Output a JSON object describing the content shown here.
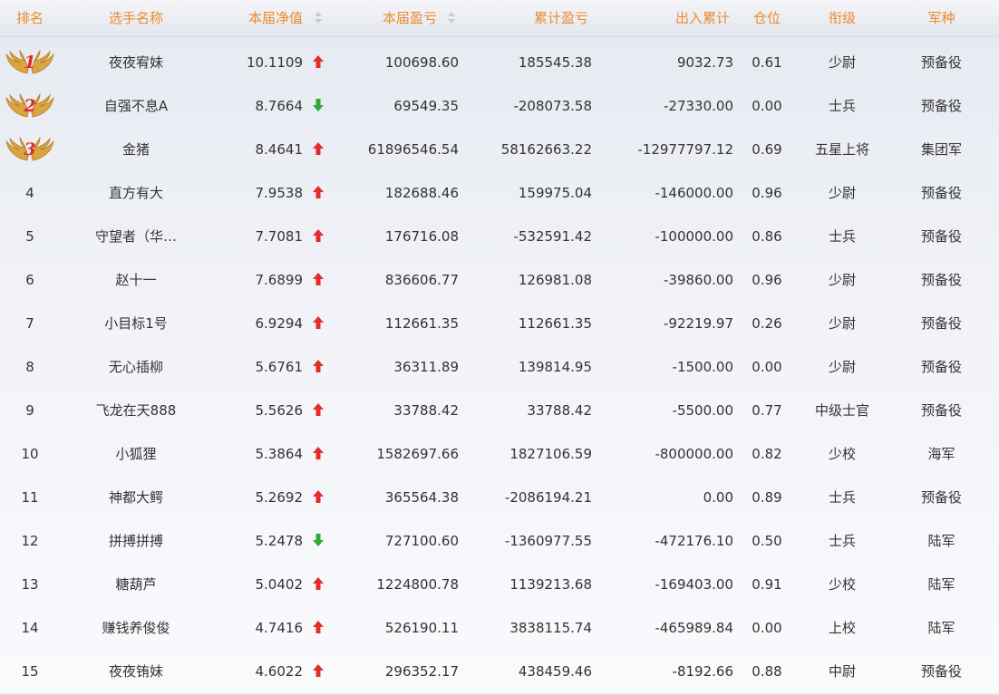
{
  "columns": {
    "rank": "排名",
    "name": "选手名称",
    "nav": "本届净值",
    "current_pl": "本届盈亏",
    "cumulative_pl": "累计盈亏",
    "flow": "出入累计",
    "position": "仓位",
    "title": "衔级",
    "army": "军种"
  },
  "colors": {
    "header_text": "#ec8a2c",
    "up": "#e32d2d",
    "down": "#2fa83a",
    "medal_number": "#e12b2b"
  },
  "rows": [
    {
      "rank": "1",
      "name": "夜夜宥妹",
      "nav": "10.1109",
      "trend": "up",
      "current_pl": "100698.60",
      "cumulative_pl": "185545.38",
      "flow": "9032.73",
      "position": "0.61",
      "title": "少尉",
      "army": "预备役",
      "medal": true
    },
    {
      "rank": "2",
      "name": "自强不息A",
      "nav": "8.7664",
      "trend": "down",
      "current_pl": "69549.35",
      "cumulative_pl": "-208073.58",
      "flow": "-27330.00",
      "position": "0.00",
      "title": "士兵",
      "army": "预备役",
      "medal": true
    },
    {
      "rank": "3",
      "name": "金猪",
      "nav": "8.4641",
      "trend": "up",
      "current_pl": "61896546.54",
      "cumulative_pl": "58162663.22",
      "flow": "-12977797.12",
      "position": "0.69",
      "title": "五星上将",
      "army": "集团军",
      "medal": true
    },
    {
      "rank": "4",
      "name": "直方有大",
      "nav": "7.9538",
      "trend": "up",
      "current_pl": "182688.46",
      "cumulative_pl": "159975.04",
      "flow": "-146000.00",
      "position": "0.96",
      "title": "少尉",
      "army": "预备役"
    },
    {
      "rank": "5",
      "name": "守望者（华…",
      "nav": "7.7081",
      "trend": "up",
      "current_pl": "176716.08",
      "cumulative_pl": "-532591.42",
      "flow": "-100000.00",
      "position": "0.86",
      "title": "士兵",
      "army": "预备役"
    },
    {
      "rank": "6",
      "name": "赵十一",
      "nav": "7.6899",
      "trend": "up",
      "current_pl": "836606.77",
      "cumulative_pl": "126981.08",
      "flow": "-39860.00",
      "position": "0.96",
      "title": "少尉",
      "army": "预备役"
    },
    {
      "rank": "7",
      "name": "小目标1号",
      "nav": "6.9294",
      "trend": "up",
      "current_pl": "112661.35",
      "cumulative_pl": "112661.35",
      "flow": "-92219.97",
      "position": "0.26",
      "title": "少尉",
      "army": "预备役"
    },
    {
      "rank": "8",
      "name": "无心插柳",
      "nav": "5.6761",
      "trend": "up",
      "current_pl": "36311.89",
      "cumulative_pl": "139814.95",
      "flow": "-1500.00",
      "position": "0.00",
      "title": "少尉",
      "army": "预备役"
    },
    {
      "rank": "9",
      "name": "飞龙在天888",
      "nav": "5.5626",
      "trend": "up",
      "current_pl": "33788.42",
      "cumulative_pl": "33788.42",
      "flow": "-5500.00",
      "position": "0.77",
      "title": "中级士官",
      "army": "预备役"
    },
    {
      "rank": "10",
      "name": "小狐狸",
      "nav": "5.3864",
      "trend": "up",
      "current_pl": "1582697.66",
      "cumulative_pl": "1827106.59",
      "flow": "-800000.00",
      "position": "0.82",
      "title": "少校",
      "army": "海军"
    },
    {
      "rank": "11",
      "name": "神都大鳄",
      "nav": "5.2692",
      "trend": "up",
      "current_pl": "365564.38",
      "cumulative_pl": "-2086194.21",
      "flow": "0.00",
      "position": "0.89",
      "title": "士兵",
      "army": "预备役"
    },
    {
      "rank": "12",
      "name": "拼搏拼搏",
      "nav": "5.2478",
      "trend": "down",
      "current_pl": "727100.60",
      "cumulative_pl": "-1360977.55",
      "flow": "-472176.10",
      "position": "0.50",
      "title": "士兵",
      "army": "陆军"
    },
    {
      "rank": "13",
      "name": "糖葫芦",
      "nav": "5.0402",
      "trend": "up",
      "current_pl": "1224800.78",
      "cumulative_pl": "1139213.68",
      "flow": "-169403.00",
      "position": "0.91",
      "title": "少校",
      "army": "陆军"
    },
    {
      "rank": "14",
      "name": "赚钱养俊俊",
      "nav": "4.7416",
      "trend": "up",
      "current_pl": "526190.11",
      "cumulative_pl": "3838115.74",
      "flow": "-465989.84",
      "position": "0.00",
      "title": "上校",
      "army": "陆军"
    },
    {
      "rank": "15",
      "name": "夜夜铕妹",
      "nav": "4.6022",
      "trend": "up",
      "current_pl": "296352.17",
      "cumulative_pl": "438459.46",
      "flow": "-8192.66",
      "position": "0.88",
      "title": "中尉",
      "army": "预备役"
    }
  ]
}
